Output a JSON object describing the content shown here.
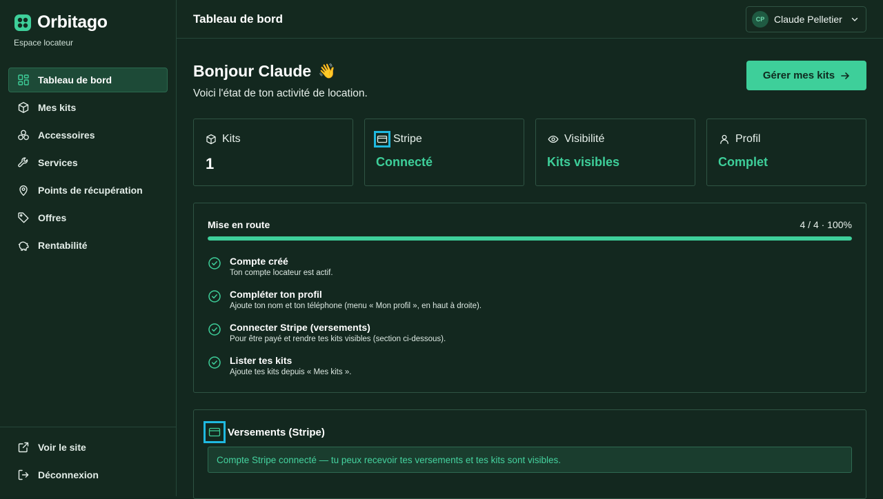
{
  "brand": {
    "name": "Orbitago",
    "subtitle": "Espace locateur",
    "accent": "#3ecf9a"
  },
  "sidebar": {
    "items": [
      {
        "label": "Tableau de bord",
        "icon": "dashboard-icon",
        "active": true
      },
      {
        "label": "Mes kits",
        "icon": "box-icon"
      },
      {
        "label": "Accessoires",
        "icon": "accessories-icon"
      },
      {
        "label": "Services",
        "icon": "wrench-icon"
      },
      {
        "label": "Points de récupération",
        "icon": "map-pin-icon"
      },
      {
        "label": "Offres",
        "icon": "tag-icon"
      },
      {
        "label": "Rentabilité",
        "icon": "piggy-bank-icon"
      }
    ],
    "bottom": [
      {
        "label": "Voir le site",
        "icon": "external-link-icon"
      },
      {
        "label": "Déconnexion",
        "icon": "logout-icon"
      }
    ]
  },
  "topbar": {
    "title": "Tableau de bord",
    "user": {
      "initials": "CP",
      "name": "Claude Pelletier"
    }
  },
  "main": {
    "greeting": "Bonjour Claude",
    "greeting_emoji": "👋",
    "subtitle": "Voici l'état de ton activité de location.",
    "cta_label": "Gérer mes kits",
    "stats": [
      {
        "label": "Kits",
        "value": "1",
        "icon": "box-icon"
      },
      {
        "label": "Stripe",
        "value": "Connecté",
        "icon": "credit-card-icon"
      },
      {
        "label": "Visibilité",
        "value": "Kits visibles",
        "icon": "eye-icon"
      },
      {
        "label": "Profil",
        "value": "Complet",
        "icon": "user-icon"
      }
    ],
    "onboarding": {
      "title": "Mise en route",
      "progress_text": "4 / 4 · 100%",
      "progress": 1.0,
      "steps": [
        {
          "title": "Compte créé",
          "desc": "Ton compte locateur est actif."
        },
        {
          "title": "Compléter ton profil",
          "desc": "Ajoute ton nom et ton téléphone (menu « Mon profil », en haut à droite)."
        },
        {
          "title": "Connecter Stripe (versements)",
          "desc": "Pour être payé et rendre tes kits visibles (section ci-dessous)."
        },
        {
          "title": "Lister tes kits",
          "desc": "Ajoute tes kits depuis « Mes kits »."
        }
      ]
    },
    "payouts": {
      "title": "Versements (Stripe)",
      "note": "Compte Stripe connecté — tu peux recevoir tes versements et tes kits sont visibles."
    }
  }
}
